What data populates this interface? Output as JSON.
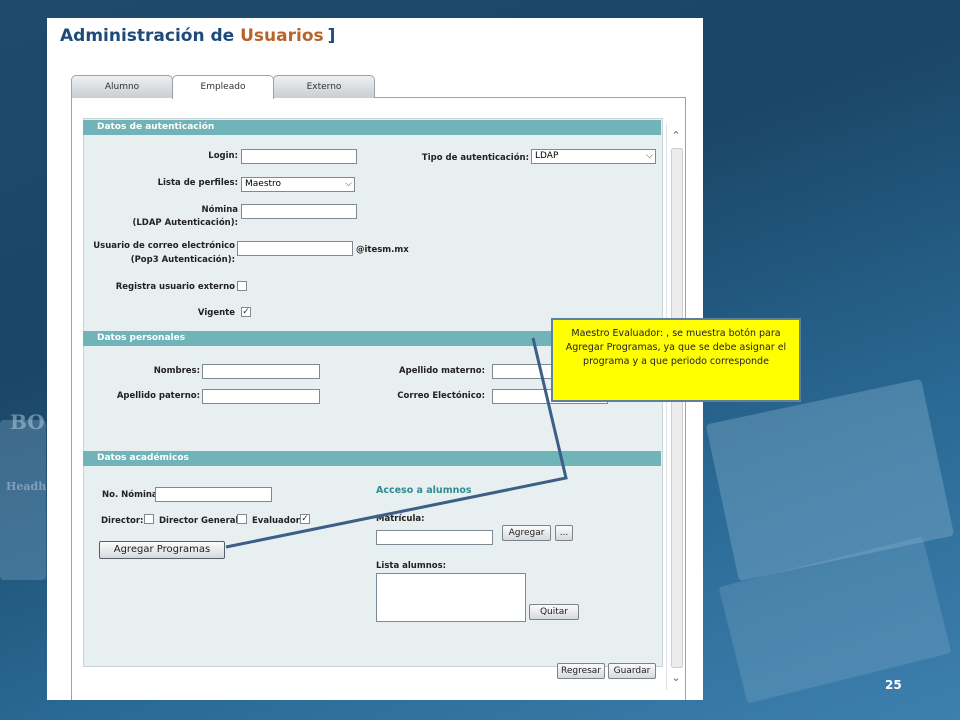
{
  "page": {
    "title_part1": "Administración de",
    "title_part2": "Usuarios",
    "title_bracket": "]",
    "page_number": "25"
  },
  "tabs": [
    {
      "label": "Alumno",
      "active": false
    },
    {
      "label": "Empleado",
      "active": true
    },
    {
      "label": "Externo",
      "active": false
    }
  ],
  "auth": {
    "section_title": "Datos de autenticación",
    "login_label": "Login:",
    "login_value": "",
    "tipo_auth_label": "Tipo de autenticación:",
    "tipo_auth_value": "LDAP",
    "perfiles_label": "Lista de perfiles:",
    "perfiles_value": "Maestro",
    "nomina_label_1": "Nómina",
    "nomina_label_2": "(LDAP Autenticación):",
    "nomina_value": "",
    "correo_label_1": "Usuario de correo electrónico",
    "correo_label_2": "(Pop3 Autenticación):",
    "correo_value": "",
    "correo_domain": "@itesm.mx",
    "externo_label": "Registra usuario externo",
    "externo_checked": false,
    "vigente_label": "Vigente",
    "vigente_checked": true
  },
  "personal": {
    "section_title": "Datos personales",
    "nombres_label": "Nombres:",
    "nombres_value": "",
    "paterno_label": "Apellido paterno:",
    "paterno_value": "",
    "materno_label": "Apellido materno:",
    "materno_value": "",
    "correo_label": "Correo Electónico:",
    "correo_value": ""
  },
  "academic": {
    "section_title": "Datos académicos",
    "nomina_label": "No. Nómina:",
    "nomina_value": "",
    "director_label": "Director:",
    "director_checked": false,
    "director_general_label": "Director General:",
    "director_general_checked": false,
    "evaluador_label": "Evaluador:",
    "evaluador_checked": true,
    "agregar_programas_label": "Agregar Programas",
    "acceso_title": "Acceso a alumnos",
    "matricula_label": "Matrícula:",
    "matricula_value": "",
    "agregar_label": "Agregar",
    "more_label": "...",
    "lista_label": "Lista alumnos:",
    "quitar_label": "Quitar"
  },
  "footer": {
    "regresar_label": "Regresar",
    "guardar_label": "Guardar"
  },
  "callout": {
    "text": "Maestro Evaluador: , se muestra botón para Agregar Programas, ya que se debe asignar el programa y a que periodo corresponde"
  },
  "background": {
    "word1": "BO",
    "word2": "Headh"
  },
  "colors": {
    "section_header": "#70b3b9",
    "panel": "#e7eff0",
    "callout": "#ffff00",
    "title_blue": "#1d4a78",
    "title_orange": "#b8632a"
  }
}
